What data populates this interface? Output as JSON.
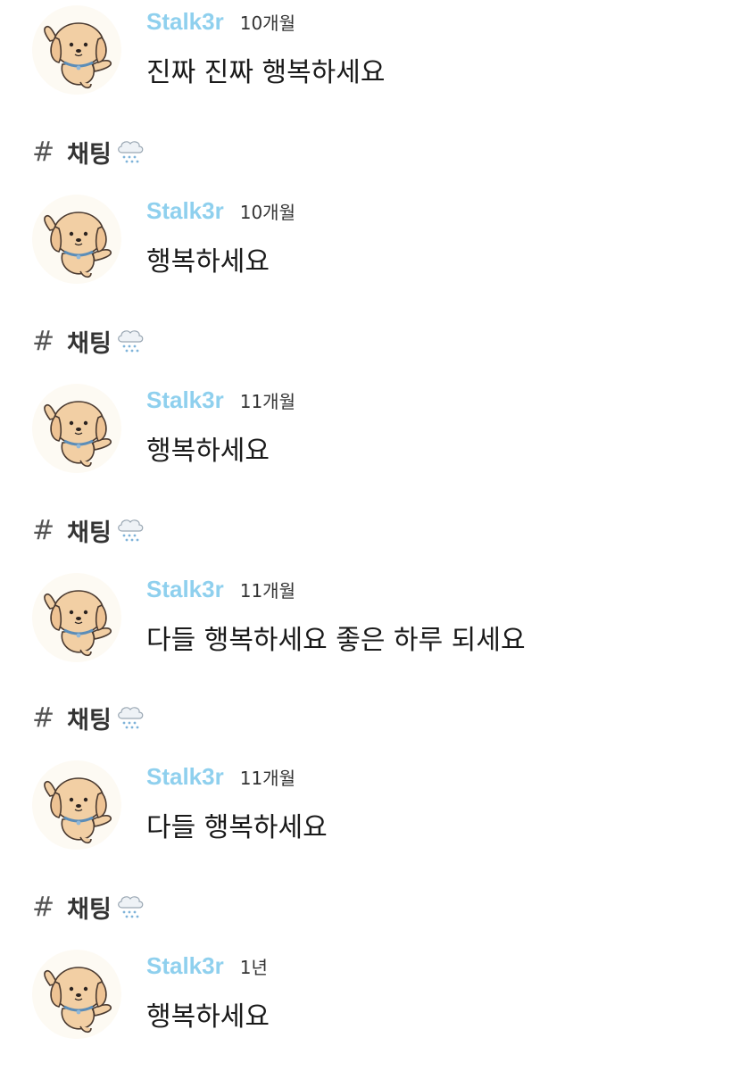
{
  "feed": {
    "messages": [
      {
        "author": "Stalk3r",
        "time": "10개월",
        "text": "진짜 진짜 행복하세요",
        "avatar_icon": "puppy-avatar-icon"
      },
      {
        "author": "Stalk3r",
        "time": "10개월",
        "text": "행복하세요",
        "avatar_icon": "puppy-avatar-icon"
      },
      {
        "author": "Stalk3r",
        "time": "11개월",
        "text": "행복하세요",
        "avatar_icon": "puppy-avatar-icon"
      },
      {
        "author": "Stalk3r",
        "time": "11개월",
        "text": "다들 행복하세요 좋은 하루 되세요",
        "avatar_icon": "puppy-avatar-icon"
      },
      {
        "author": "Stalk3r",
        "time": "11개월",
        "text": "다들 행복하세요",
        "avatar_icon": "puppy-avatar-icon"
      },
      {
        "author": "Stalk3r",
        "time": "1년",
        "text": "행복하세요",
        "avatar_icon": "puppy-avatar-icon"
      }
    ],
    "channels": [
      {
        "hash": "#",
        "name": "채팅",
        "icon": "rain-cloud-icon"
      },
      {
        "hash": "#",
        "name": "채팅",
        "icon": "rain-cloud-icon"
      },
      {
        "hash": "#",
        "name": "채팅",
        "icon": "rain-cloud-icon"
      },
      {
        "hash": "#",
        "name": "채팅",
        "icon": "rain-cloud-icon"
      },
      {
        "hash": "#",
        "name": "채팅",
        "icon": "rain-cloud-icon"
      }
    ]
  },
  "colors": {
    "author": "#8fd0ee",
    "text": "#1a1a1a",
    "channel": "#333333",
    "avatar_bg": "#fdfaf3",
    "puppy": "#f2cfa4"
  }
}
